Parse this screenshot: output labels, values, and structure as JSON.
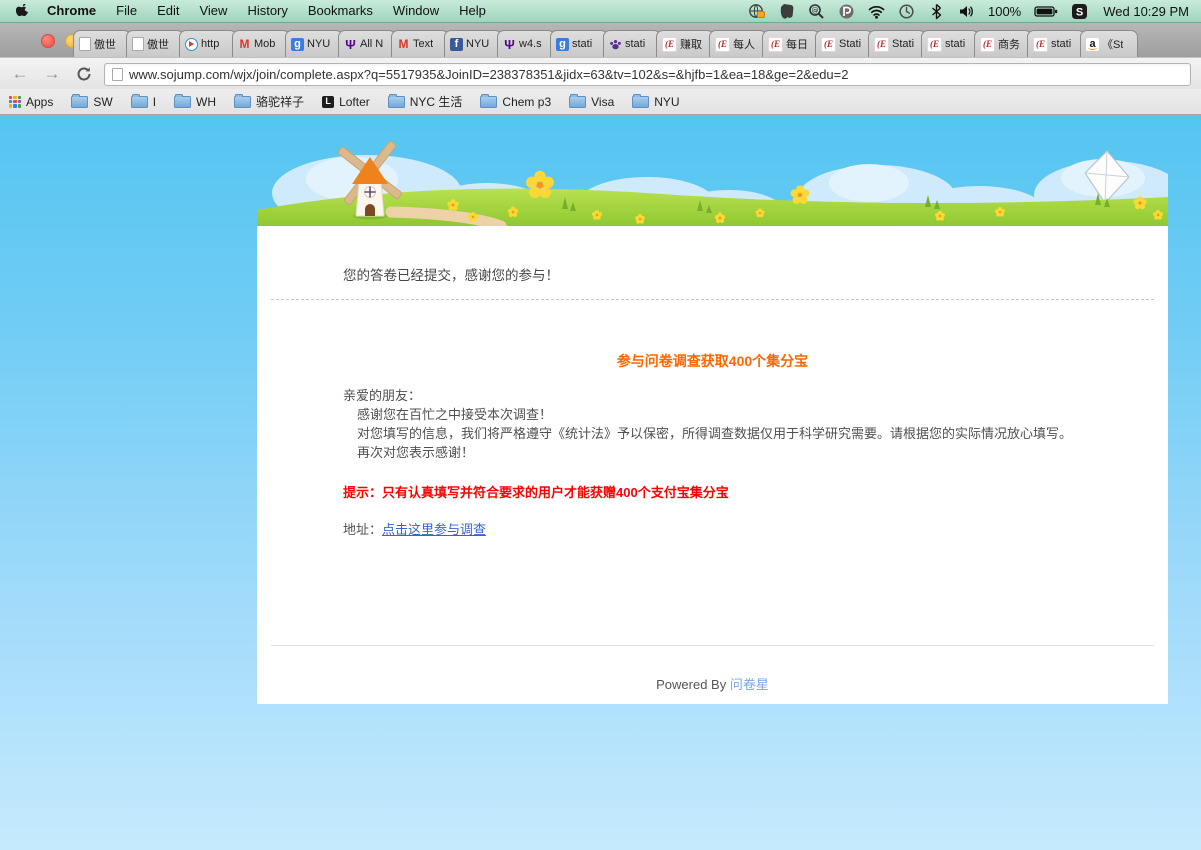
{
  "menu_bar": {
    "app_name": "Chrome",
    "items": [
      "File",
      "Edit",
      "View",
      "History",
      "Bookmarks",
      "Window",
      "Help"
    ],
    "status": {
      "icons": [
        "globe-lock",
        "evernote",
        "search-badge",
        "p-badge",
        "wifi",
        "time-machine",
        "bluetooth",
        "volume",
        "battery",
        "s-app"
      ],
      "battery_percent": "100%",
      "clock": "Wed 10:29 PM"
    }
  },
  "window": {
    "tabs": [
      {
        "icon": "doc",
        "label": "傲世"
      },
      {
        "icon": "doc",
        "label": "傲世"
      },
      {
        "icon": "play",
        "label": "http"
      },
      {
        "icon": "gmail",
        "label": "Mob"
      },
      {
        "icon": "google-g",
        "label": "NYU"
      },
      {
        "icon": "nyu-torch",
        "label": "All N"
      },
      {
        "icon": "gmail",
        "label": "Text"
      },
      {
        "icon": "facebook",
        "label": "NYU"
      },
      {
        "icon": "nyu-torch",
        "label": "w4.s"
      },
      {
        "icon": "google-g",
        "label": "stati"
      },
      {
        "icon": "paw",
        "label": "stati"
      },
      {
        "icon": "e-forum",
        "label": "赚取"
      },
      {
        "icon": "e-forum",
        "label": "每人"
      },
      {
        "icon": "e-forum",
        "label": "每日"
      },
      {
        "icon": "e-forum",
        "label": "Stati"
      },
      {
        "icon": "e-forum",
        "label": "Stati"
      },
      {
        "icon": "e-forum",
        "label": "stati"
      },
      {
        "icon": "e-forum",
        "label": "商务"
      },
      {
        "icon": "e-forum",
        "label": "stati"
      },
      {
        "icon": "amazon",
        "label": "《St"
      }
    ]
  },
  "toolbar": {
    "url": "www.sojump.com/wjx/join/complete.aspx?q=5517935&JoinID=238378351&jidx=63&tv=102&s=&hjfb=1&ea=18&ge=2&edu=2"
  },
  "bookmarks": {
    "items": [
      {
        "icon": "apps-grid",
        "label": "Apps"
      },
      {
        "icon": "folder",
        "label": "SW"
      },
      {
        "icon": "folder",
        "label": "I"
      },
      {
        "icon": "folder",
        "label": "WH"
      },
      {
        "icon": "folder",
        "label": "骆驼祥子"
      },
      {
        "icon": "lofter",
        "label": "Lofter"
      },
      {
        "icon": "folder",
        "label": "NYC 生活"
      },
      {
        "icon": "folder",
        "label": "Chem p3"
      },
      {
        "icon": "folder",
        "label": "Visa"
      },
      {
        "icon": "folder",
        "label": "NYU"
      }
    ]
  },
  "page": {
    "submitted_message": "您的答卷已经提交，感谢您的参与！",
    "promo_heading": "参与问卷调查获取400个集分宝",
    "greeting": "亲爱的朋友：",
    "para_line1": "感谢您在百忙之中接受本次调查！",
    "para_line2": "对您填写的信息，我们将严格遵守《统计法》予以保密，所得调查数据仅用于科学研究需要。请根据您的实际情况放心填写。",
    "para_line3": "再次对您表示感谢！",
    "notice": "提示：只有认真填写并符合要求的用户才能获赠400个支付宝集分宝",
    "address_label": "地址：",
    "address_link": "点击这里参与调查",
    "powered_by": "Powered By",
    "brand": "问卷星",
    "colors": {
      "promo_orange": "#ff6600",
      "notice_red": "#ff0000",
      "link_blue": "#3366cc",
      "brand_blue": "#76a7e0"
    }
  }
}
